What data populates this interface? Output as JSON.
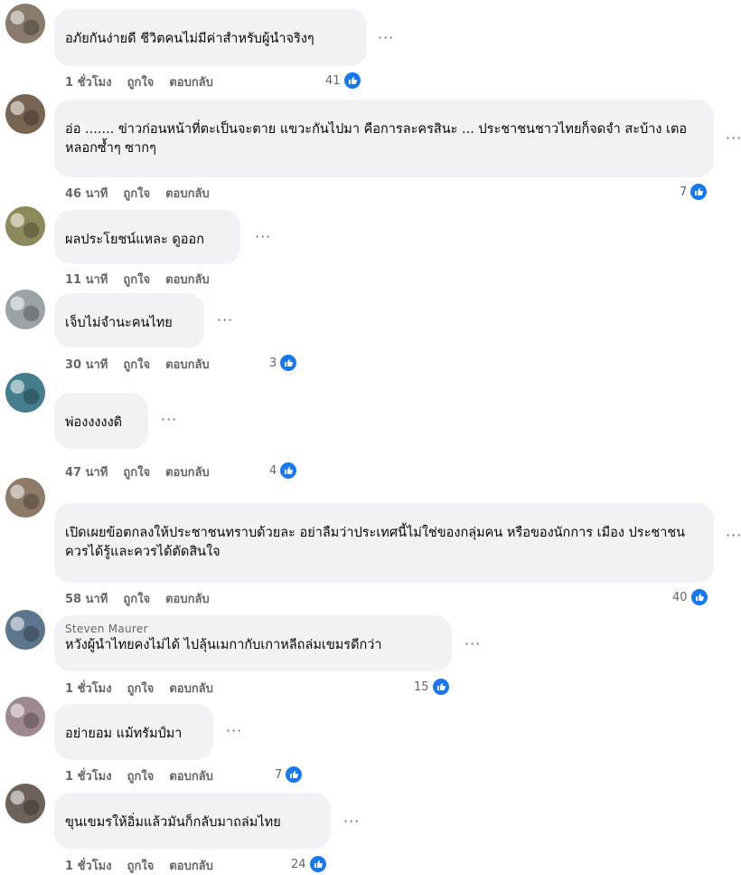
{
  "comments": [
    {
      "author": "",
      "text": "อภัยกันง่ายดี ชีวิตคนไม่มีค่าสำหรับผู้นำจริงๆ",
      "time": "1 ชั่วโมง",
      "like_label": "ถูกใจ",
      "reply_label": "ตอบกลับ",
      "reactions": "41",
      "avatar_color": "#8a7a6a"
    },
    {
      "author": "",
      "text": "อ่อ ....... ข่าวก่อนหน้าที่ตะเป็นจะตาย แขวะกันไปมา คือการละครสินะ ... ประชาชนชาวไทยก็จดจำ สะบ้าง เตอหลอกซ้ำๆ ซากๆ",
      "time": "46 นาที",
      "like_label": "ถูกใจ",
      "reply_label": "ตอบกลับ",
      "reactions": "7",
      "avatar_color": "#7a6450"
    },
    {
      "author": "",
      "text": "ผลประโยชน์แหละ ดูออก",
      "time": "11 นาที",
      "like_label": "ถูกใจ",
      "reply_label": "ตอบกลับ",
      "reactions": "",
      "avatar_color": "#8d8a55"
    },
    {
      "author": "",
      "text": "เจ็บไม่จำนะคนไทย",
      "time": "30 นาที",
      "like_label": "ถูกใจ",
      "reply_label": "ตอบกลับ",
      "reactions": "3",
      "avatar_color": "#9aa3a8"
    },
    {
      "author": "",
      "text": "พ่องงงงงดิ",
      "time": "47 นาที",
      "like_label": "ถูกใจ",
      "reply_label": "ตอบกลับ",
      "reactions": "4",
      "avatar_color": "#3f7f8f"
    },
    {
      "author": "",
      "text": "เปิดเผยข้อตกลงให้ประชาชนทราบด้วยละ อย่าลืมว่าประเทศนี้ไม่ใช่ของกลุ่มคน หรือของนักการ เมือง ประชาชนควรได้รู้และควรได้ตัดสินใจ",
      "time": "58 นาที",
      "like_label": "ถูกใจ",
      "reply_label": "ตอบกลับ",
      "reactions": "40",
      "avatar_color": "#8f7a66"
    },
    {
      "author": "Steven Maurer",
      "text": "หวังผู้นำไทยคงไม่ได้ ไปลุ้นเมกากับเกาหลีถล่มเขมรดีกว่า",
      "time": "1 ชั่วโมง",
      "like_label": "ถูกใจ",
      "reply_label": "ตอบกลับ",
      "reactions": "15",
      "avatar_color": "#5a7690"
    },
    {
      "author": "",
      "text": "อย่ายอม แม้ทรัมป์มา",
      "time": "1 ชั่วโมง",
      "like_label": "ถูกใจ",
      "reply_label": "ตอบกลับ",
      "reactions": "7",
      "avatar_color": "#a08890"
    },
    {
      "author": "",
      "text": "ขุนเขมรให้อิ่มแล้วมันก็กลับมาถล่มไทย",
      "time": "1 ชั่วโมง",
      "like_label": "ถูกใจ",
      "reply_label": "ตอบกลับ",
      "reactions": "24",
      "avatar_color": "#6e6258"
    }
  ],
  "more_icon": "more-dots-icon",
  "like_icon": "thumbs-up-icon",
  "accent_color": "#1877f2"
}
